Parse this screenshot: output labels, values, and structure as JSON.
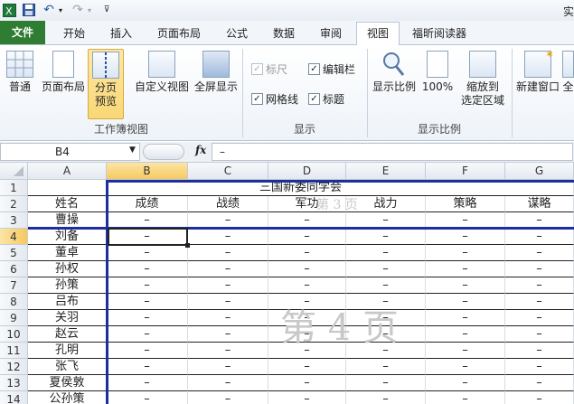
{
  "qat": {
    "icons": [
      "excel-icon",
      "save-icon",
      "undo-icon",
      "redo-icon",
      "customize-icon"
    ],
    "title_fragment": "实"
  },
  "tabs": [
    {
      "label": "文件",
      "name": "tab-file"
    },
    {
      "label": "开始",
      "name": "tab-home"
    },
    {
      "label": "插入",
      "name": "tab-insert"
    },
    {
      "label": "页面布局",
      "name": "tab-page-layout"
    },
    {
      "label": "公式",
      "name": "tab-formulas"
    },
    {
      "label": "数据",
      "name": "tab-data"
    },
    {
      "label": "审阅",
      "name": "tab-review"
    },
    {
      "label": "视图",
      "name": "tab-view",
      "active": true
    },
    {
      "label": "福昕阅读器",
      "name": "tab-foxit"
    }
  ],
  "ribbon": {
    "workbook_views": {
      "normal": "普通",
      "page_layout": "页面布局",
      "page_break_1": "分页",
      "page_break_2": "预览",
      "custom_views": "自定义视图",
      "full_screen": "全屏显示",
      "group_label": "工作簿视图"
    },
    "show": {
      "ruler": "标尺",
      "formula_bar": "编辑栏",
      "gridlines": "网格线",
      "headings": "标题",
      "group_label": "显示"
    },
    "zoom": {
      "zoom": "显示比例",
      "zoom100": "100%",
      "zoom_selection_1": "缩放到",
      "zoom_selection_2": "选定区域",
      "group_label": "显示比例"
    },
    "window": {
      "new_window": "新建窗口",
      "arrange_fragment": "全"
    }
  },
  "formula_bar": {
    "name_box": "B4",
    "fx": "fx",
    "value": "–"
  },
  "sheet": {
    "columns": [
      "A",
      "B",
      "C",
      "D",
      "E",
      "F",
      "G"
    ],
    "rows": [
      "1",
      "2",
      "3",
      "4",
      "5",
      "6",
      "7",
      "8",
      "9",
      "10",
      "11",
      "12",
      "13",
      "14"
    ],
    "title": "三国新委同学会",
    "headers": [
      "姓名",
      "成绩",
      "战绩",
      "军功",
      "战力",
      "策略",
      "谋略"
    ],
    "names": [
      "曹操",
      "刘备",
      "董卓",
      "孙权",
      "孙策",
      "吕布",
      "关羽",
      "赵云",
      "孔明",
      "张飞",
      "夏侯敦",
      "公孙策"
    ],
    "dash": "–",
    "page_watermark_small": "第 3 页",
    "page_watermark_big": "第 4 页"
  }
}
